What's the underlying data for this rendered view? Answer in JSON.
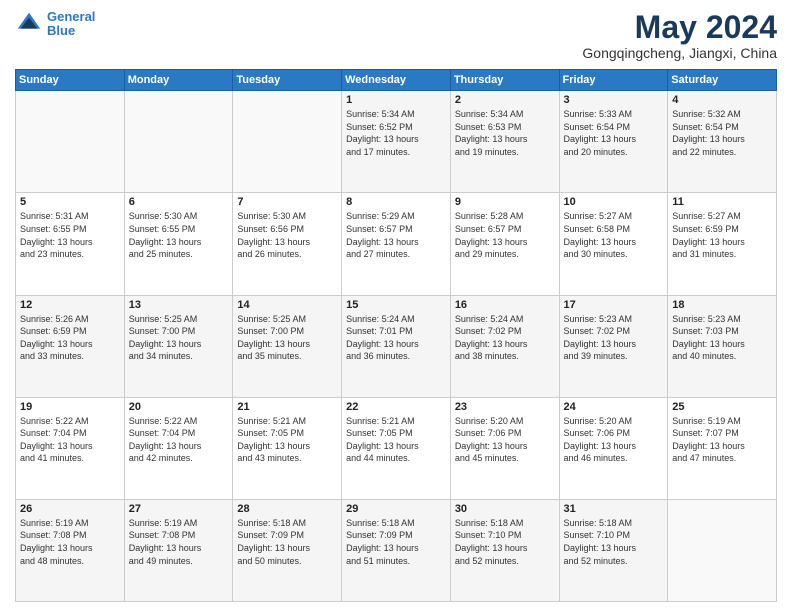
{
  "header": {
    "logo_line1": "General",
    "logo_line2": "Blue",
    "month_title": "May 2024",
    "location": "Gongqingcheng, Jiangxi, China"
  },
  "weekdays": [
    "Sunday",
    "Monday",
    "Tuesday",
    "Wednesday",
    "Thursday",
    "Friday",
    "Saturday"
  ],
  "weeks": [
    [
      {
        "day": "",
        "info": ""
      },
      {
        "day": "",
        "info": ""
      },
      {
        "day": "",
        "info": ""
      },
      {
        "day": "1",
        "info": "Sunrise: 5:34 AM\nSunset: 6:52 PM\nDaylight: 13 hours\nand 17 minutes."
      },
      {
        "day": "2",
        "info": "Sunrise: 5:34 AM\nSunset: 6:53 PM\nDaylight: 13 hours\nand 19 minutes."
      },
      {
        "day": "3",
        "info": "Sunrise: 5:33 AM\nSunset: 6:54 PM\nDaylight: 13 hours\nand 20 minutes."
      },
      {
        "day": "4",
        "info": "Sunrise: 5:32 AM\nSunset: 6:54 PM\nDaylight: 13 hours\nand 22 minutes."
      }
    ],
    [
      {
        "day": "5",
        "info": "Sunrise: 5:31 AM\nSunset: 6:55 PM\nDaylight: 13 hours\nand 23 minutes."
      },
      {
        "day": "6",
        "info": "Sunrise: 5:30 AM\nSunset: 6:55 PM\nDaylight: 13 hours\nand 25 minutes."
      },
      {
        "day": "7",
        "info": "Sunrise: 5:30 AM\nSunset: 6:56 PM\nDaylight: 13 hours\nand 26 minutes."
      },
      {
        "day": "8",
        "info": "Sunrise: 5:29 AM\nSunset: 6:57 PM\nDaylight: 13 hours\nand 27 minutes."
      },
      {
        "day": "9",
        "info": "Sunrise: 5:28 AM\nSunset: 6:57 PM\nDaylight: 13 hours\nand 29 minutes."
      },
      {
        "day": "10",
        "info": "Sunrise: 5:27 AM\nSunset: 6:58 PM\nDaylight: 13 hours\nand 30 minutes."
      },
      {
        "day": "11",
        "info": "Sunrise: 5:27 AM\nSunset: 6:59 PM\nDaylight: 13 hours\nand 31 minutes."
      }
    ],
    [
      {
        "day": "12",
        "info": "Sunrise: 5:26 AM\nSunset: 6:59 PM\nDaylight: 13 hours\nand 33 minutes."
      },
      {
        "day": "13",
        "info": "Sunrise: 5:25 AM\nSunset: 7:00 PM\nDaylight: 13 hours\nand 34 minutes."
      },
      {
        "day": "14",
        "info": "Sunrise: 5:25 AM\nSunset: 7:00 PM\nDaylight: 13 hours\nand 35 minutes."
      },
      {
        "day": "15",
        "info": "Sunrise: 5:24 AM\nSunset: 7:01 PM\nDaylight: 13 hours\nand 36 minutes."
      },
      {
        "day": "16",
        "info": "Sunrise: 5:24 AM\nSunset: 7:02 PM\nDaylight: 13 hours\nand 38 minutes."
      },
      {
        "day": "17",
        "info": "Sunrise: 5:23 AM\nSunset: 7:02 PM\nDaylight: 13 hours\nand 39 minutes."
      },
      {
        "day": "18",
        "info": "Sunrise: 5:23 AM\nSunset: 7:03 PM\nDaylight: 13 hours\nand 40 minutes."
      }
    ],
    [
      {
        "day": "19",
        "info": "Sunrise: 5:22 AM\nSunset: 7:04 PM\nDaylight: 13 hours\nand 41 minutes."
      },
      {
        "day": "20",
        "info": "Sunrise: 5:22 AM\nSunset: 7:04 PM\nDaylight: 13 hours\nand 42 minutes."
      },
      {
        "day": "21",
        "info": "Sunrise: 5:21 AM\nSunset: 7:05 PM\nDaylight: 13 hours\nand 43 minutes."
      },
      {
        "day": "22",
        "info": "Sunrise: 5:21 AM\nSunset: 7:05 PM\nDaylight: 13 hours\nand 44 minutes."
      },
      {
        "day": "23",
        "info": "Sunrise: 5:20 AM\nSunset: 7:06 PM\nDaylight: 13 hours\nand 45 minutes."
      },
      {
        "day": "24",
        "info": "Sunrise: 5:20 AM\nSunset: 7:06 PM\nDaylight: 13 hours\nand 46 minutes."
      },
      {
        "day": "25",
        "info": "Sunrise: 5:19 AM\nSunset: 7:07 PM\nDaylight: 13 hours\nand 47 minutes."
      }
    ],
    [
      {
        "day": "26",
        "info": "Sunrise: 5:19 AM\nSunset: 7:08 PM\nDaylight: 13 hours\nand 48 minutes."
      },
      {
        "day": "27",
        "info": "Sunrise: 5:19 AM\nSunset: 7:08 PM\nDaylight: 13 hours\nand 49 minutes."
      },
      {
        "day": "28",
        "info": "Sunrise: 5:18 AM\nSunset: 7:09 PM\nDaylight: 13 hours\nand 50 minutes."
      },
      {
        "day": "29",
        "info": "Sunrise: 5:18 AM\nSunset: 7:09 PM\nDaylight: 13 hours\nand 51 minutes."
      },
      {
        "day": "30",
        "info": "Sunrise: 5:18 AM\nSunset: 7:10 PM\nDaylight: 13 hours\nand 52 minutes."
      },
      {
        "day": "31",
        "info": "Sunrise: 5:18 AM\nSunset: 7:10 PM\nDaylight: 13 hours\nand 52 minutes."
      },
      {
        "day": "",
        "info": ""
      }
    ]
  ]
}
